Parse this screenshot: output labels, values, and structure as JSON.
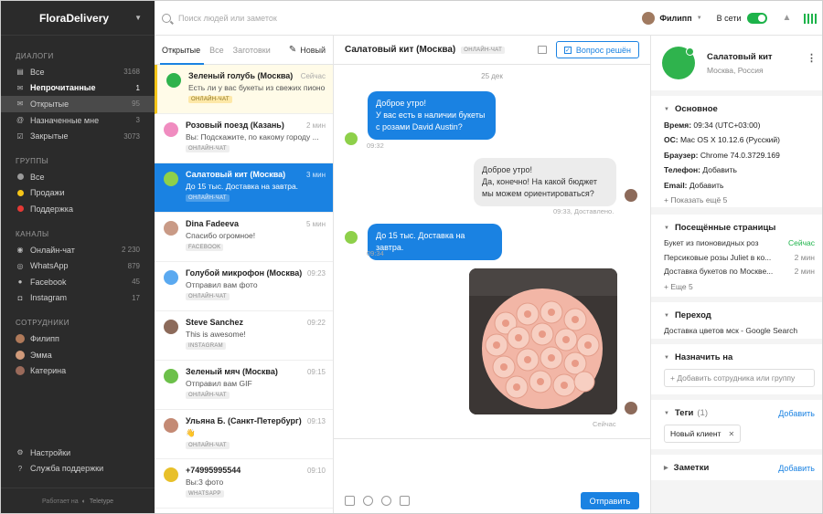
{
  "sidebar": {
    "brand": "FloraDelivery",
    "sections": {
      "dialogs": "ДИАЛОГИ",
      "groups": "ГРУППЫ",
      "channels": "КАНАЛЫ",
      "staff": "СОТРУДНИКИ"
    },
    "dialogs": [
      {
        "label": "Все",
        "count": "3168",
        "icon": "inbox-icon"
      },
      {
        "label": "Непрочитанные",
        "count": "1",
        "icon": "mail-icon"
      },
      {
        "label": "Открытые",
        "count": "95",
        "icon": "open-mail-icon"
      },
      {
        "label": "Назначенные мне",
        "count": "3",
        "icon": "at-icon"
      },
      {
        "label": "Закрытые",
        "count": "3073",
        "icon": "check-box-icon"
      }
    ],
    "groups": [
      {
        "label": "Все",
        "color": "#9a9a9a"
      },
      {
        "label": "Продажи",
        "color": "#f5c518"
      },
      {
        "label": "Поддержка",
        "color": "#e53935"
      }
    ],
    "channels": [
      {
        "label": "Онлайн-чат",
        "count": "2 230",
        "icon": "chat-icon"
      },
      {
        "label": "WhatsApp",
        "count": "879",
        "icon": "whatsapp-icon"
      },
      {
        "label": "Facebook",
        "count": "45",
        "icon": "facebook-icon"
      },
      {
        "label": "Instagram",
        "count": "17",
        "icon": "instagram-icon"
      }
    ],
    "staff": [
      {
        "label": "Филипп"
      },
      {
        "label": "Эмма"
      },
      {
        "label": "Катерина"
      }
    ],
    "settings": "Настройки",
    "support": "Служба поддержки",
    "powered_by": "Работает на",
    "powered_brand": "Teletype"
  },
  "topbar": {
    "search_placeholder": "Поиск людей или заметок",
    "user_name": "Филипп",
    "online_label": "В сети"
  },
  "list": {
    "tabs": [
      "Открытые",
      "Все",
      "Заготовки"
    ],
    "new_label": "Новый",
    "items": [
      {
        "name": "Зеленый голубь (Москва)",
        "time": "Сейчас",
        "msg": "Есть ли у вас букеты из свежих пионо...",
        "tag": "ОНЛАЙН-ЧАТ",
        "color": "#2fb34d"
      },
      {
        "name": "Розовый поезд (Казань)",
        "time": "2 мин",
        "msg": "Вы: Подскажите, по какому городу ...",
        "tag": "ОНЛАЙН-ЧАТ",
        "color": "#f08cc0"
      },
      {
        "name": "Салатовый кит (Москва)",
        "time": "3 мин",
        "msg": "До 15 тыс. Доставка на завтра.",
        "tag": "ОНЛАЙН-ЧАТ",
        "color": "#8ed04a"
      },
      {
        "name": "Dina Fadeeva",
        "time": "5 мин",
        "msg": "Спасибо огромное!",
        "tag": "FACEBOOK",
        "color": "#c99a86"
      },
      {
        "name": "Голубой микрофон (Москва)",
        "time": "09:23",
        "msg": "Отправил вам фото",
        "tag": "ОНЛАЙН-ЧАТ",
        "color": "#5aa9f0"
      },
      {
        "name": "Steve Sanchez",
        "time": "09:22",
        "msg": "This is awesome!",
        "tag": "INSTAGRAM",
        "color": "#8c6a5a"
      },
      {
        "name": "Зеленый мяч (Москва)",
        "time": "09:15",
        "msg": "Отправил вам GIF",
        "tag": "ОНЛАЙН-ЧАТ",
        "color": "#6cc04a"
      },
      {
        "name": "Ульяна Б. (Санкт-Петербург)",
        "time": "09:13",
        "msg": "👋",
        "tag": "ОНЛАЙН-ЧАТ",
        "color": "#c48a74"
      },
      {
        "name": "+74995995544",
        "time": "09:10",
        "msg": "Вы:3 фото",
        "tag": "WHATSAPP",
        "color": "#e8c02a"
      }
    ]
  },
  "chat": {
    "title": "Салатовый кит (Москва)",
    "channel_tag": "ОНЛАЙН-ЧАТ",
    "resolved_label": "Вопрос решён",
    "date": "25 дек",
    "messages": [
      {
        "dir": "out",
        "lines": [
          "Доброе утро!",
          "У вас есть в наличии букеты",
          "с розами David Austin?"
        ],
        "time": "09:32"
      },
      {
        "dir": "in",
        "lines": [
          "Доброе утро!",
          "Да, конечно! На какой бюджет",
          "мы можем ориентироваться?"
        ],
        "time": "09:33, Доставлено."
      },
      {
        "dir": "out",
        "lines": [
          "До 15 тыс. Доставка на завтра."
        ],
        "time": "09:34"
      },
      {
        "dir": "in",
        "image": true,
        "time": "Сейчас"
      }
    ],
    "send_label": "Отправить"
  },
  "contact": {
    "name": "Салатовый кит",
    "location": "Москва, Россия",
    "basic_title": "Основное",
    "basic": [
      {
        "k": "Время:",
        "v": "09:34 (UTC+03:00)"
      },
      {
        "k": "ОС:",
        "v": "Mac OS X 10.12.6 (Русский)"
      },
      {
        "k": "Браузер:",
        "v": "Chrome 74.0.3729.169"
      },
      {
        "k": "Телефон:",
        "v": "Добавить"
      },
      {
        "k": "Email:",
        "v": "Добавить"
      }
    ],
    "show_more": "Показать ещё 5",
    "pages_title": "Посещённые страницы",
    "pages": [
      {
        "p": "Букет из пионовидных роз",
        "w": "Сейчас"
      },
      {
        "p": "Персиковые розы Juliet в ко...",
        "w": "2 мин"
      },
      {
        "p": "Доставка букетов по Москве...",
        "w": "2 мин"
      }
    ],
    "pages_more": "Еще 5",
    "ref_title": "Переход",
    "ref_value": "Доставка цветов мск - Google Search",
    "assign_title": "Назначить на",
    "assign_placeholder": "Добавить сотрудника или группу",
    "tags_title": "Теги",
    "tags_count": "(1)",
    "add_label": "Добавить",
    "tag_value": "Новый клиент",
    "notes_title": "Заметки"
  },
  "colors": {
    "accent": "#1a82e2",
    "online": "#1db34a",
    "sidebar_bg": "#2b2b2b"
  }
}
